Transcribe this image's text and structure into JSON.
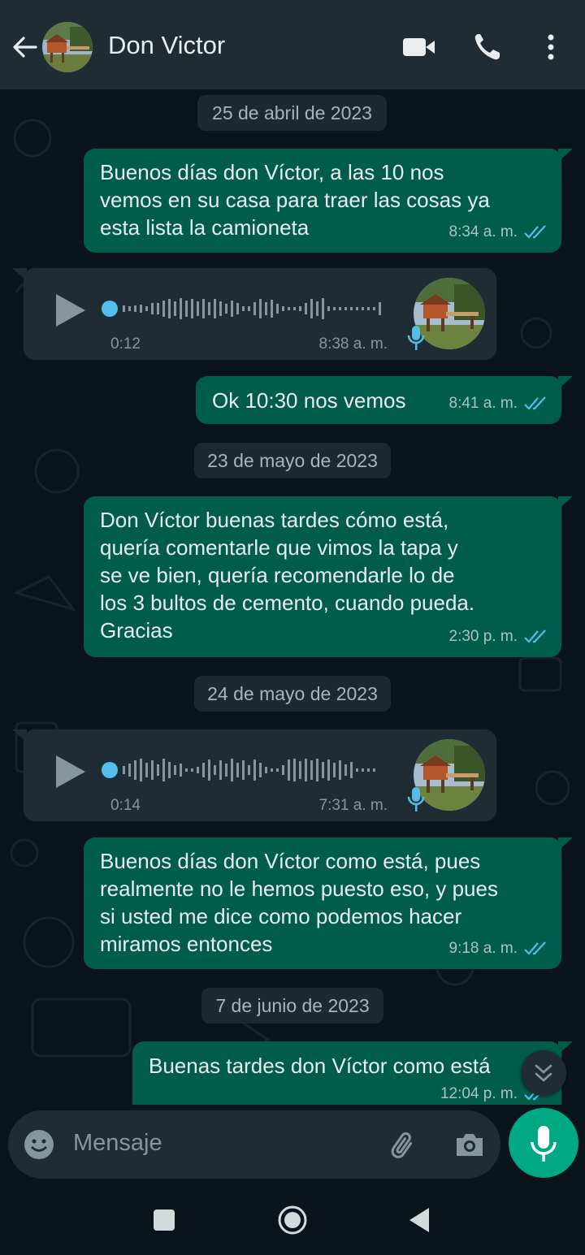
{
  "header": {
    "contact_name": "Don Victor"
  },
  "messages": [
    {
      "type": "date",
      "text": "25 de abril de 2023"
    },
    {
      "type": "out",
      "lines": [
        "Buenos días don Víctor, a las 10 nos",
        "vemos en su casa para traer las cosas ya",
        "esta lista la camioneta"
      ],
      "time": "8:34 a. m."
    },
    {
      "type": "voice",
      "duration": "0:12",
      "time": "8:38 a. m."
    },
    {
      "type": "out",
      "lines": [
        "Ok 10:30 nos vemos"
      ],
      "time": "8:41 a. m."
    },
    {
      "type": "date",
      "text": "23 de mayo de 2023"
    },
    {
      "type": "out",
      "lines": [
        "Don Víctor buenas tardes cómo está,",
        "quería comentarle que vimos la tapa y",
        "se ve bien, quería recomendarle lo de",
        "los 3 bultos de cemento, cuando pueda.",
        "Gracias"
      ],
      "time": "2:30 p. m."
    },
    {
      "type": "date",
      "text": "24 de mayo de 2023"
    },
    {
      "type": "voice",
      "duration": "0:14",
      "time": "7:31 a. m."
    },
    {
      "type": "out",
      "lines": [
        "Buenos días don Víctor como está, pues",
        "realmente no le hemos puesto eso, y pues",
        "si usted me dice como podemos hacer",
        "miramos entonces"
      ],
      "time": "9:18 a. m."
    },
    {
      "type": "date",
      "text": "7 de junio de 2023"
    },
    {
      "type": "out",
      "lines": [
        "Buenas tardes don Víctor como está"
      ],
      "time": "12:04 p. m."
    }
  ],
  "input": {
    "placeholder": "Mensaje"
  },
  "colors": {
    "outgoing_bubble": "#005c4b",
    "incoming_bubble": "#1f2c34",
    "accent": "#00a884",
    "read_ticks": "#53bdeb"
  },
  "icons": [
    "back-arrow-icon",
    "video-call-icon",
    "phone-icon",
    "more-options-icon",
    "play-icon",
    "microphone-icon",
    "emoji-icon",
    "attach-icon",
    "camera-icon",
    "scroll-down-icon",
    "nav-recents-icon",
    "nav-home-icon",
    "nav-back-icon"
  ]
}
